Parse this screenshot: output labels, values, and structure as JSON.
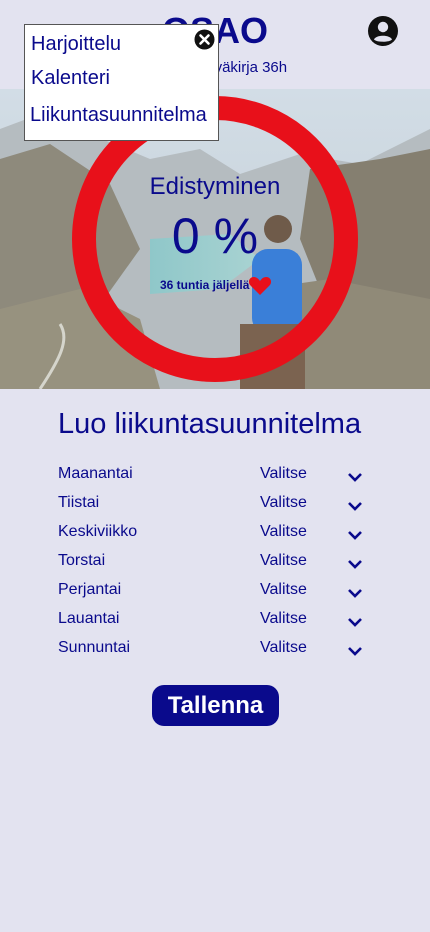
{
  "header": {
    "brand": "OSAO",
    "subtitle": "Liikuntapäiväkirja 36h"
  },
  "progress": {
    "title": "Edistyminen",
    "value": "0 %",
    "fraction": 0,
    "remaining": "36 tuntia jäljellä"
  },
  "menu": {
    "items": [
      "Harjoittelu",
      "Kalenteri",
      "Liikuntasuunnitelma"
    ]
  },
  "plan": {
    "title": "Luo liikuntasuunnitelma",
    "days": [
      {
        "day": "Maanantai",
        "select": "Valitse"
      },
      {
        "day": "Tiistai",
        "select": "Valitse"
      },
      {
        "day": "Keskiviikko",
        "select": "Valitse"
      },
      {
        "day": "Torstai",
        "select": "Valitse"
      },
      {
        "day": "Perjantai",
        "select": "Valitse"
      },
      {
        "day": "Lauantai",
        "select": "Valitse"
      },
      {
        "day": "Sunnuntai",
        "select": "Valitse"
      }
    ]
  },
  "save_label": "Tallenna",
  "colors": {
    "primary": "#0a0a8c",
    "ring": "#e8101a",
    "background": "#e3e3f0",
    "heart": "#e8101a"
  }
}
